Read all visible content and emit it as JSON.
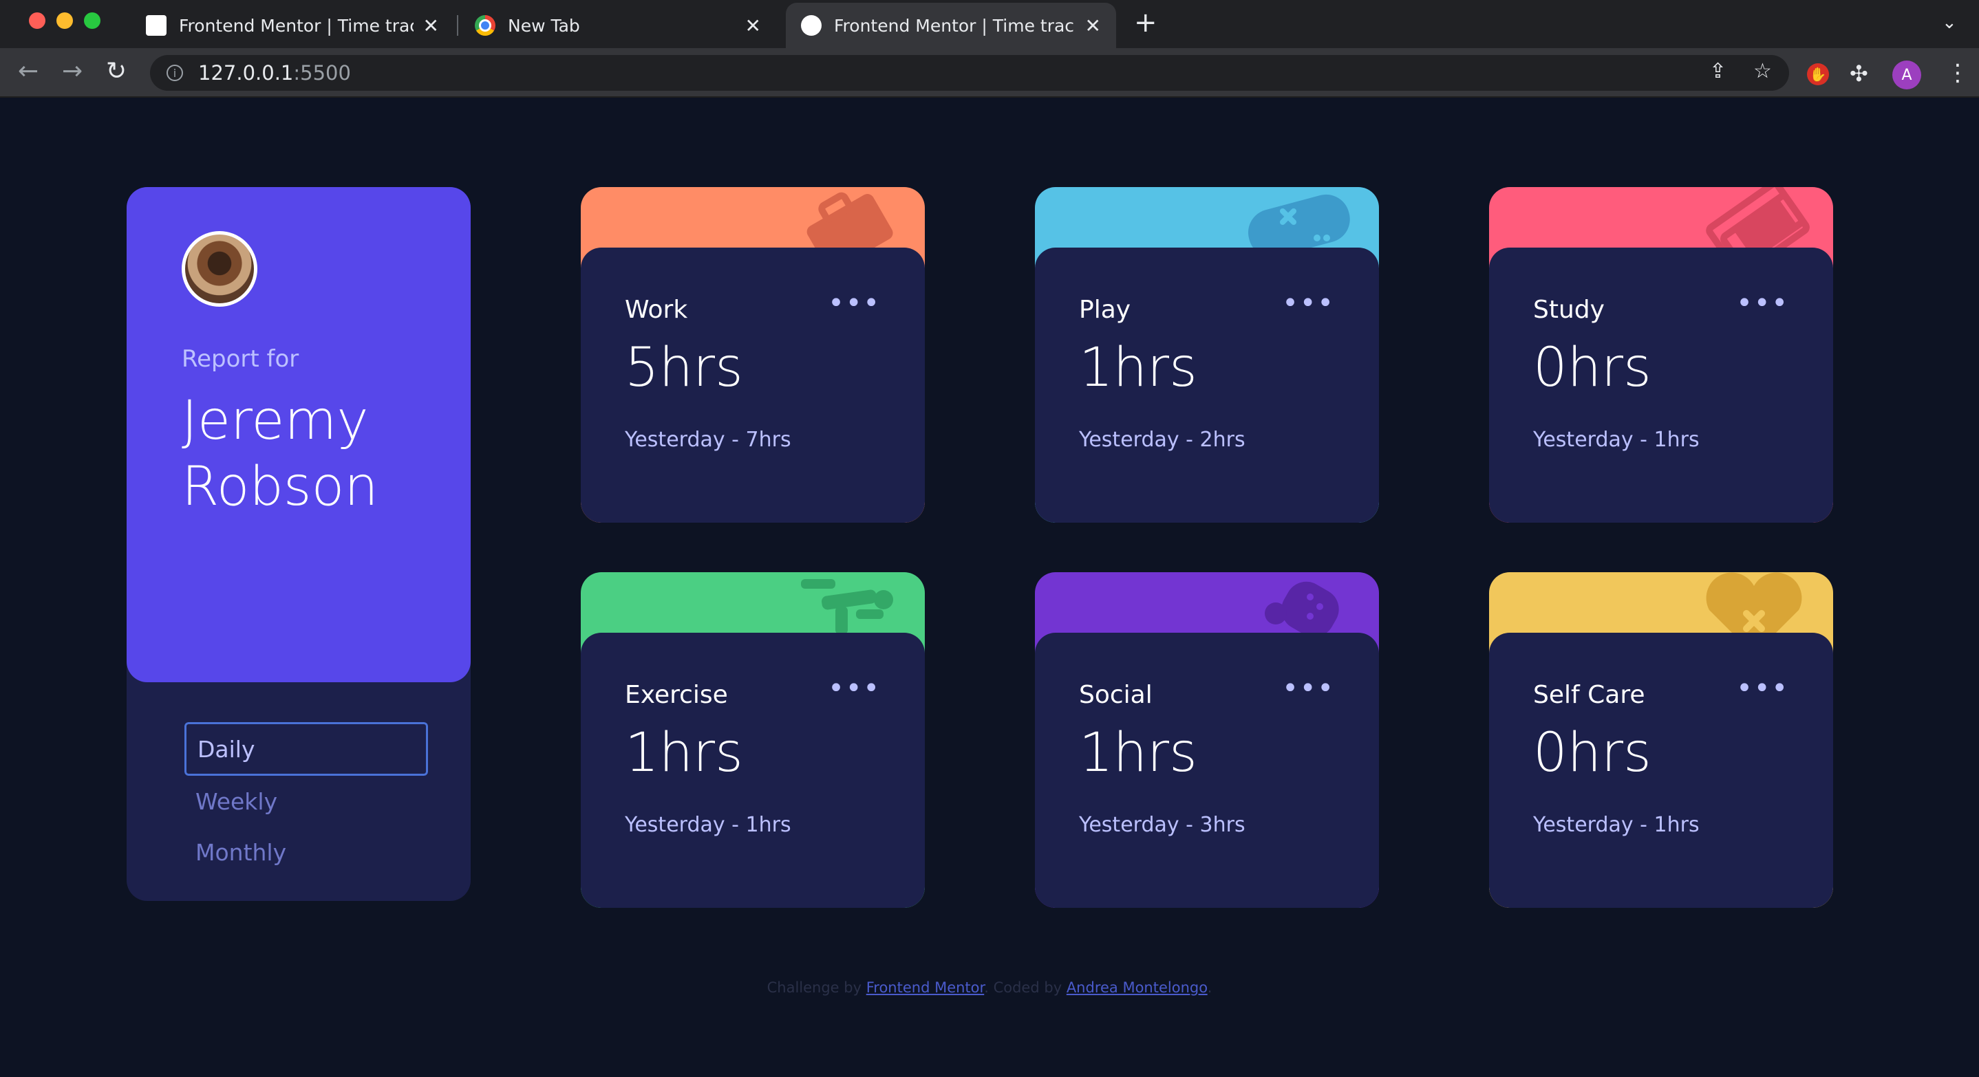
{
  "browser": {
    "tabs": [
      {
        "title": "Frontend Mentor | Time tracking",
        "active": false
      },
      {
        "title": "New Tab",
        "active": false
      },
      {
        "title": "Frontend Mentor | Time tracking",
        "active": true
      }
    ],
    "url_host": "127.0.0.1",
    "url_port": ":5500",
    "profile_initial": "A"
  },
  "profile": {
    "report_for": "Report for",
    "name": "Jeremy Robson",
    "periods": [
      "Daily",
      "Weekly",
      "Monthly"
    ],
    "active_period": "Daily"
  },
  "cards": [
    {
      "title": "Work",
      "hours": "5hrs",
      "previous": "Yesterday - 7hrs",
      "color": "#ff8c66",
      "icon": "briefcase-icon"
    },
    {
      "title": "Play",
      "hours": "1hrs",
      "previous": "Yesterday - 2hrs",
      "color": "#56c2e6",
      "icon": "gamepad-icon"
    },
    {
      "title": "Study",
      "hours": "0hrs",
      "previous": "Yesterday - 1hrs",
      "color": "#ff5c7c",
      "icon": "book-icon"
    },
    {
      "title": "Exercise",
      "hours": "1hrs",
      "previous": "Yesterday - 1hrs",
      "color": "#4bcf83",
      "icon": "running-icon"
    },
    {
      "title": "Social",
      "hours": "1hrs",
      "previous": "Yesterday - 3hrs",
      "color": "#7335d2",
      "icon": "social-icon"
    },
    {
      "title": "Self Care",
      "hours": "0hrs",
      "previous": "Yesterday - 1hrs",
      "color": "#f1c75b",
      "icon": "heart-icon"
    }
  ],
  "footer": {
    "challenge_by": "Challenge by",
    "challenge_link": "Frontend Mentor",
    "coded_by": "Coded by",
    "coder_link": "Andrea Montelongo"
  }
}
